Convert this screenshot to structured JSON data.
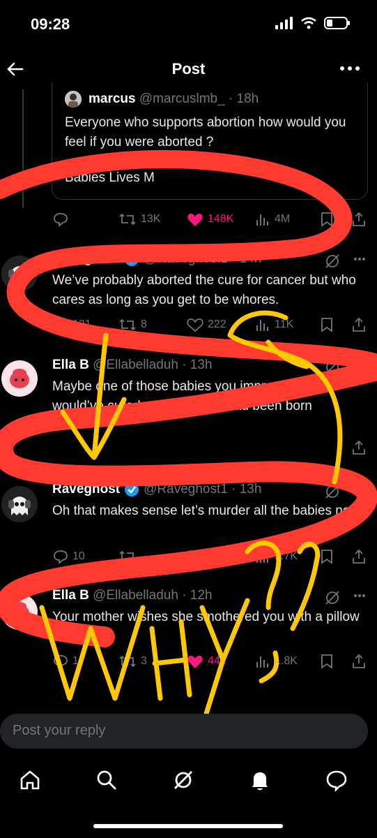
{
  "status": {
    "time": "09:28"
  },
  "header": {
    "title": "Post"
  },
  "quote": {
    "name": "marcus",
    "handle": "@marcuslmb_",
    "time": "· 18h",
    "text": "Everyone who supports abortion how would you feel if you were aborted ?",
    "text2": "Babies Lives M",
    "retweets": "13K",
    "likes": "148K",
    "views": "4M"
  },
  "replies": [
    {
      "name": "Raveghost",
      "handle": "@Raveghost1",
      "time": "· 14h",
      "text": "We’ve probably aborted the cure for cancer but who cares as long as you get to be whores.",
      "replies": "121",
      "retweets": "8",
      "likes": "222",
      "views": "11K"
    },
    {
      "name": "Ella B",
      "handle": "@Ellabelladuh",
      "time": "· 13h",
      "text": "Maybe one of those babies you impregnated would’ve cured cancer if they had been born",
      "replies": "",
      "retweets": "",
      "likes": "",
      "views": ""
    },
    {
      "name": "Raveghost",
      "handle": "@Raveghost1",
      "time": "· 13h",
      "text": "Oh that makes sense let’s murder all the babies now.",
      "replies": "10",
      "retweets": "",
      "likes": "5",
      "views": "5.7K"
    },
    {
      "name": "Ella B",
      "handle": "@Ellabelladuh",
      "time": "· 12h",
      "text": "Your mother wishes she smothered you with a pillow as a baby",
      "replies": "1",
      "retweets": "3",
      "likes": "442",
      "views": "1.8K"
    }
  ],
  "reply_bar": {
    "placeholder": "Post your reply"
  },
  "annotation": {
    "text": "WHY ?!"
  },
  "colors": {
    "like": "#f91880",
    "verified": "#1d9bf0",
    "red_scribble": "#ff3b30",
    "yellow_scribble": "#ffc800"
  }
}
